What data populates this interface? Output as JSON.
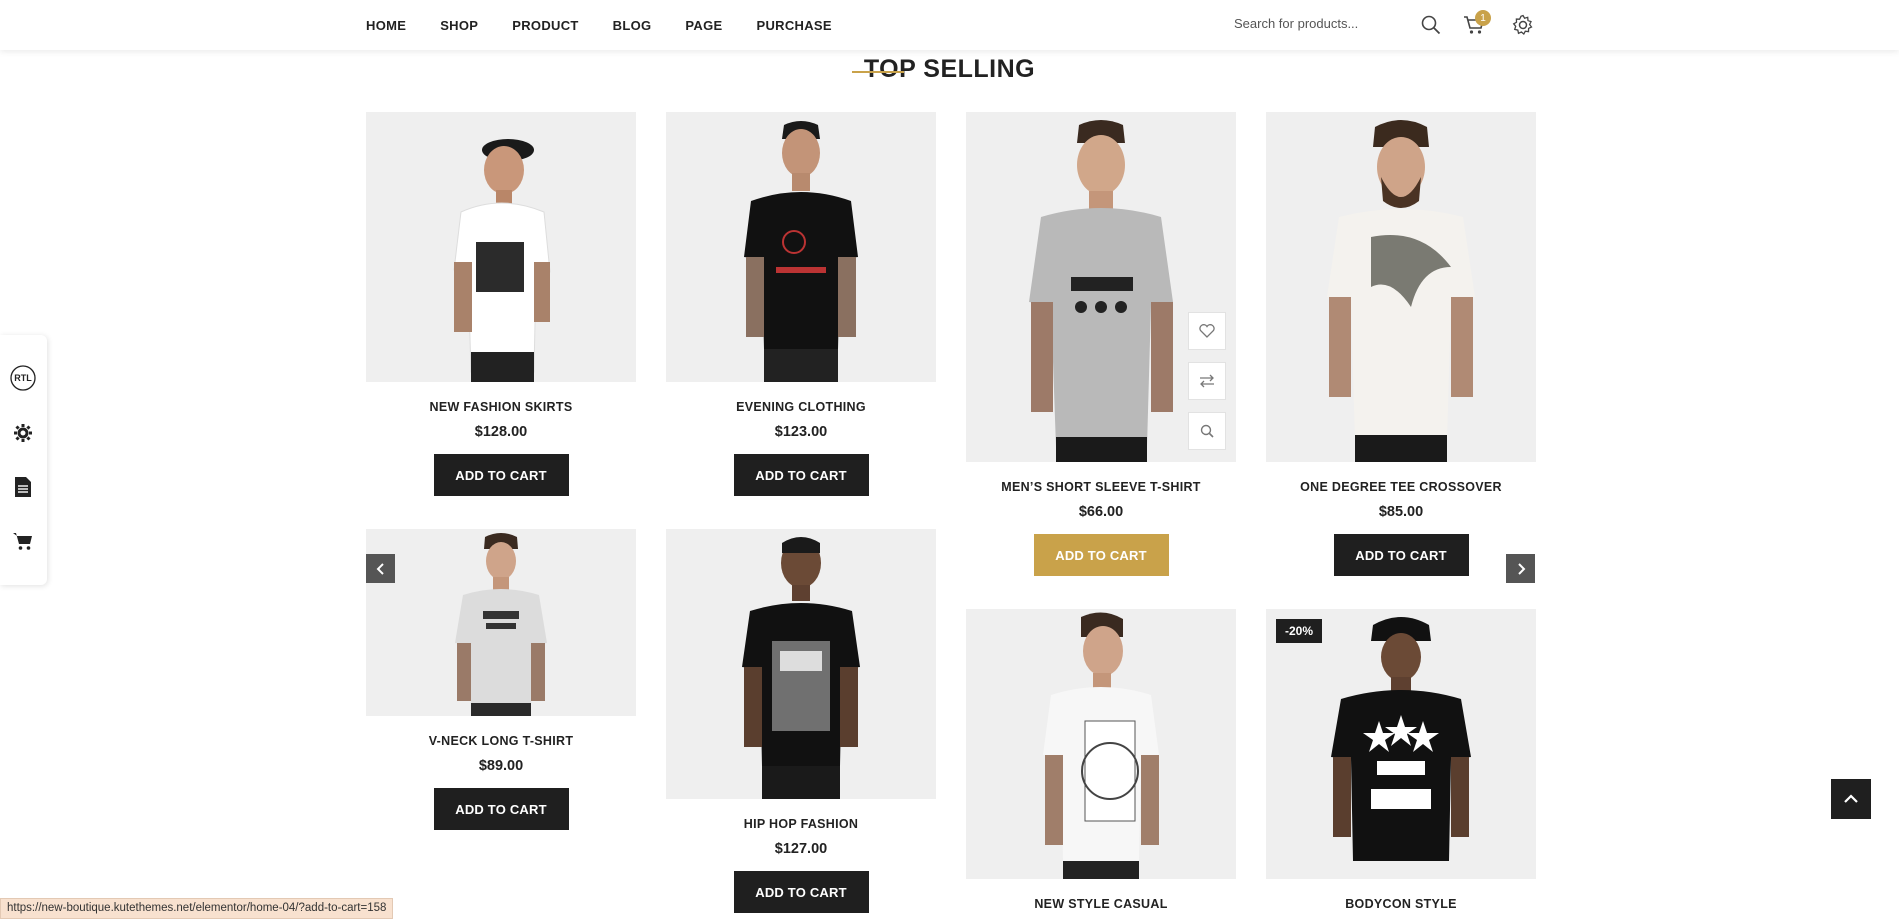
{
  "nav": {
    "items": [
      "HOME",
      "SHOP",
      "PRODUCT",
      "BLOG",
      "PAGE",
      "PURCHASE"
    ],
    "search_placeholder": "Search for products...",
    "cart_count": "1"
  },
  "section": {
    "title": "TOP SELLING"
  },
  "products": [
    {
      "name": "NEW FASHION SKIRTS",
      "price": "$128.00",
      "button": "ADD TO CART"
    },
    {
      "name": "EVENING CLOTHING",
      "price": "$123.00",
      "button": "ADD TO CART"
    },
    {
      "name": "MEN’S SHORT SLEEVE T-SHIRT",
      "price": "$66.00",
      "button": "ADD TO CART"
    },
    {
      "name": "ONE DEGREE TEE CROSSOVER",
      "price": "$85.00",
      "button": "ADD TO CART"
    },
    {
      "name": "V-NECK LONG T-SHIRT",
      "price": "$89.00",
      "button": "ADD TO CART"
    },
    {
      "name": "HIP HOP FASHION",
      "price": "$127.00",
      "button": "ADD TO CART"
    },
    {
      "name": "NEW STYLE CASUAL",
      "price": "",
      "button": ""
    },
    {
      "name": "BODYCON STYLE",
      "price": "",
      "button": "",
      "badge": "-20%"
    }
  ],
  "left_panel": {
    "rtl_label": "RTL"
  },
  "status_url": "https://new-boutique.kutethemes.net/elementor/home-04/?add-to-cart=158",
  "colors": {
    "accent": "#c9a24a",
    "dark_button": "#1f1f1f",
    "image_bg": "#efefef"
  }
}
